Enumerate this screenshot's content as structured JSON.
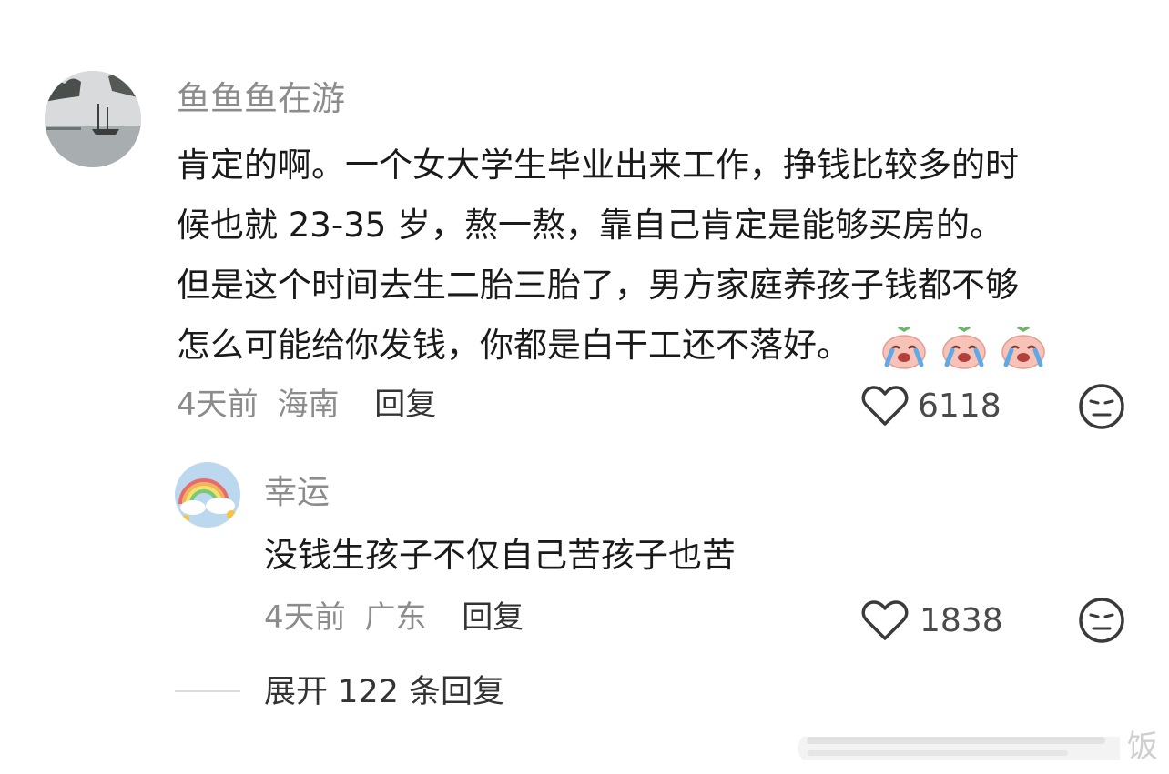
{
  "comment": {
    "username": "鱼鱼鱼在游",
    "text_lines": [
      "肯定的啊。一个女大学生毕业出来工作，挣钱比较多的时",
      "候也就 23-35 岁，熬一熬，靠自己肯定是能够买房的。",
      "但是这个时间去生二胎三胎了，男方家庭养孩子钱都不够",
      "怎么可能给你发钱，你都是白干工还不落好。"
    ],
    "emojis": [
      "crying-peach-emoji",
      "crying-peach-emoji",
      "crying-peach-emoji"
    ],
    "time": "4天前",
    "location": "海南",
    "reply_label": "回复",
    "likes": "6118"
  },
  "reply": {
    "username": "幸运",
    "text": "没钱生孩子不仅自己苦孩子也苦",
    "time": "4天前",
    "location": "广东",
    "reply_label": "回复",
    "likes": "1838"
  },
  "expand": {
    "label": "展开 122 条回复"
  },
  "watermark": {
    "text": "饭"
  },
  "colors": {
    "text": "#1a1a1a",
    "muted": "#8c8c8c",
    "icon": "#3a3a3a"
  }
}
